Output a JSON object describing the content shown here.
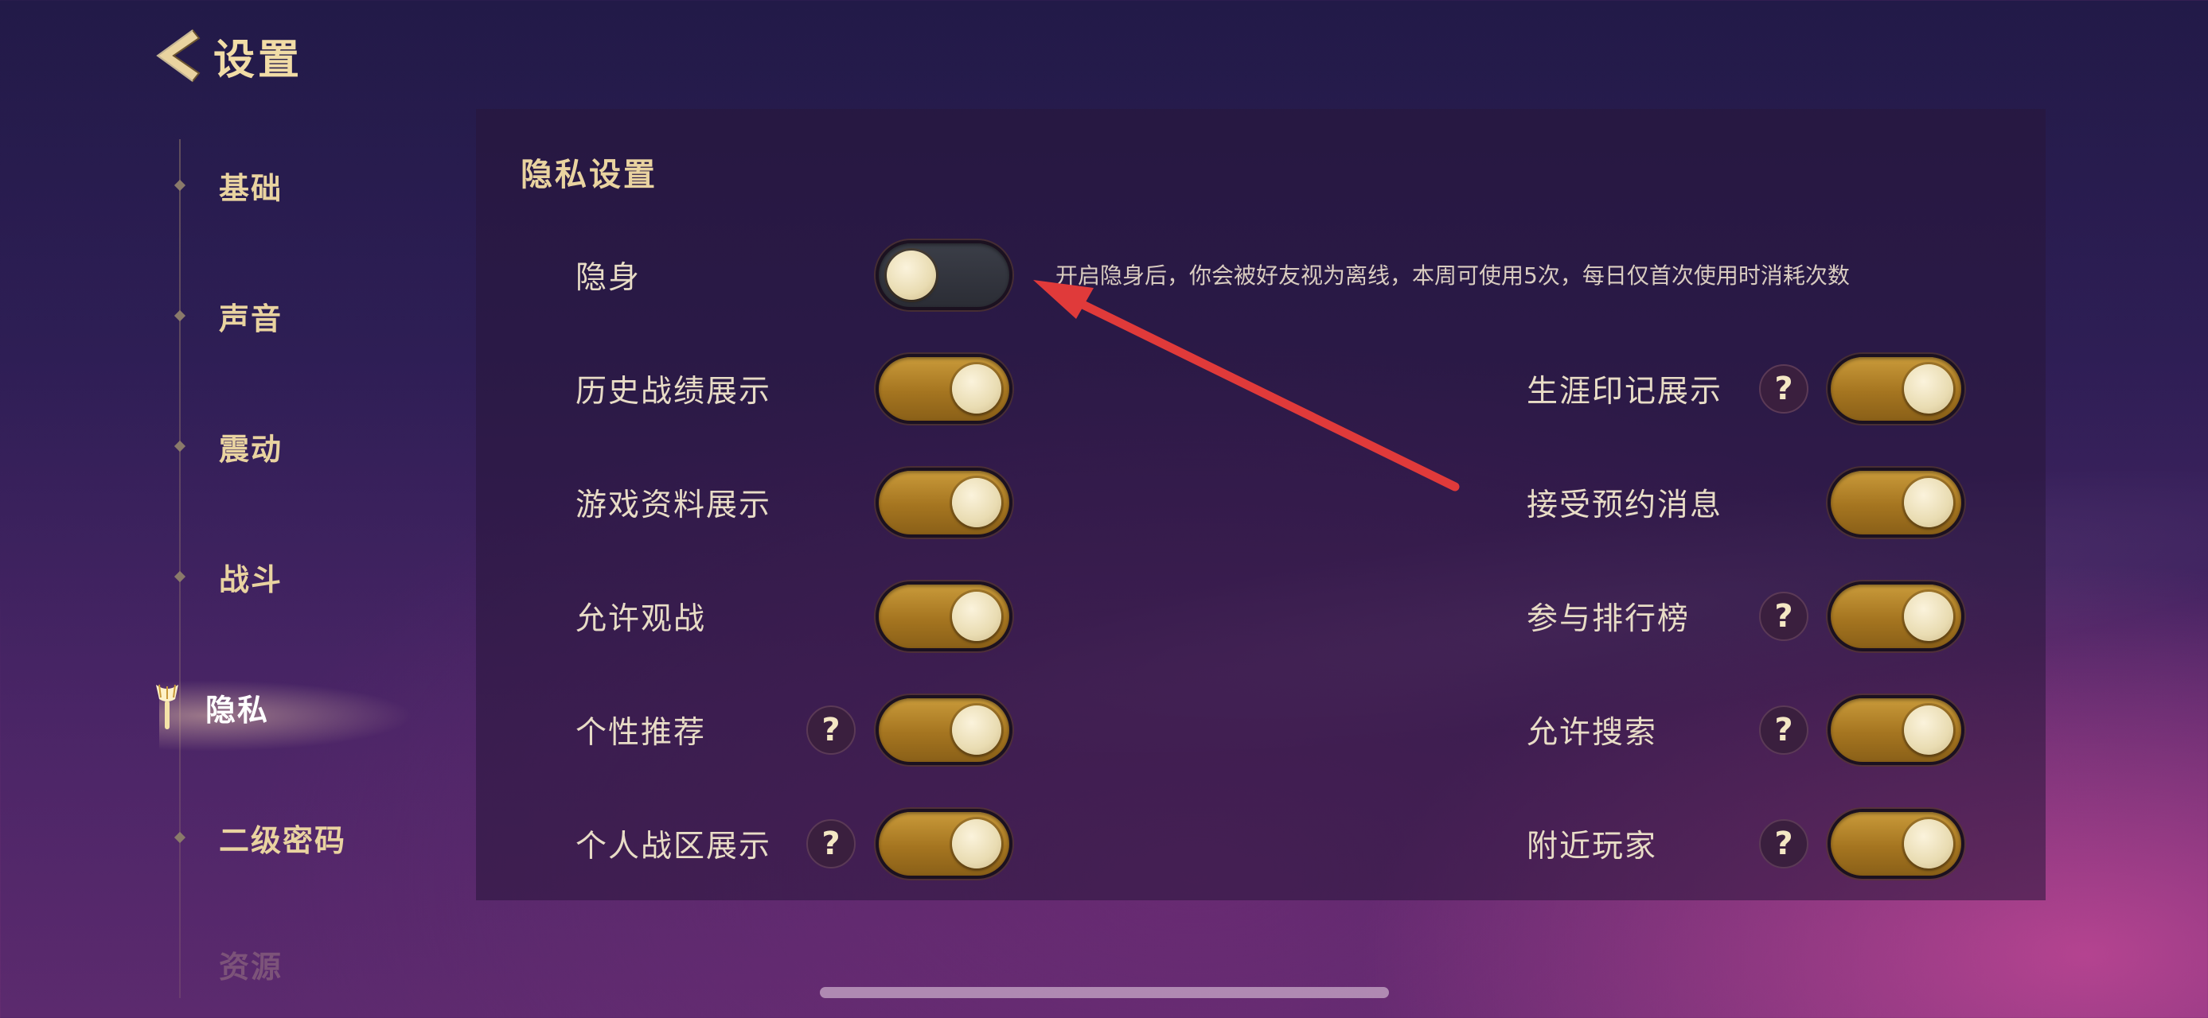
{
  "header": {
    "title": "设置"
  },
  "sidebar": {
    "items": [
      {
        "label": "基础"
      },
      {
        "label": "声音"
      },
      {
        "label": "震动"
      },
      {
        "label": "战斗"
      },
      {
        "label": "隐私",
        "active": true
      },
      {
        "label": "二级密码"
      },
      {
        "label": "资源"
      }
    ]
  },
  "panel": {
    "title": "隐私设置",
    "stealth": {
      "label": "隐身",
      "state": "off",
      "hint": "开启隐身后，你会被好友视为离线，本周可使用5次，每日仅首次使用时消耗次数"
    },
    "left_settings": [
      {
        "label": "历史战绩展示",
        "state": "on",
        "help": false
      },
      {
        "label": "游戏资料展示",
        "state": "on",
        "help": false
      },
      {
        "label": "允许观战",
        "state": "on",
        "help": false
      },
      {
        "label": "个性推荐",
        "state": "on",
        "help": true
      },
      {
        "label": "个人战区展示",
        "state": "on",
        "help": true
      }
    ],
    "right_settings": [
      {
        "label": "生涯印记展示",
        "state": "on",
        "help": true
      },
      {
        "label": "接受预约消息",
        "state": "on",
        "help": false
      },
      {
        "label": "参与排行榜",
        "state": "on",
        "help": true
      },
      {
        "label": "允许搜索",
        "state": "on",
        "help": true
      },
      {
        "label": "附近玩家",
        "state": "on",
        "help": true
      }
    ],
    "help_glyph": "?"
  },
  "colors": {
    "accent_gold": "#c99a3a",
    "label_gold": "#e9d3a0",
    "annotation_red": "#e03a3a"
  }
}
